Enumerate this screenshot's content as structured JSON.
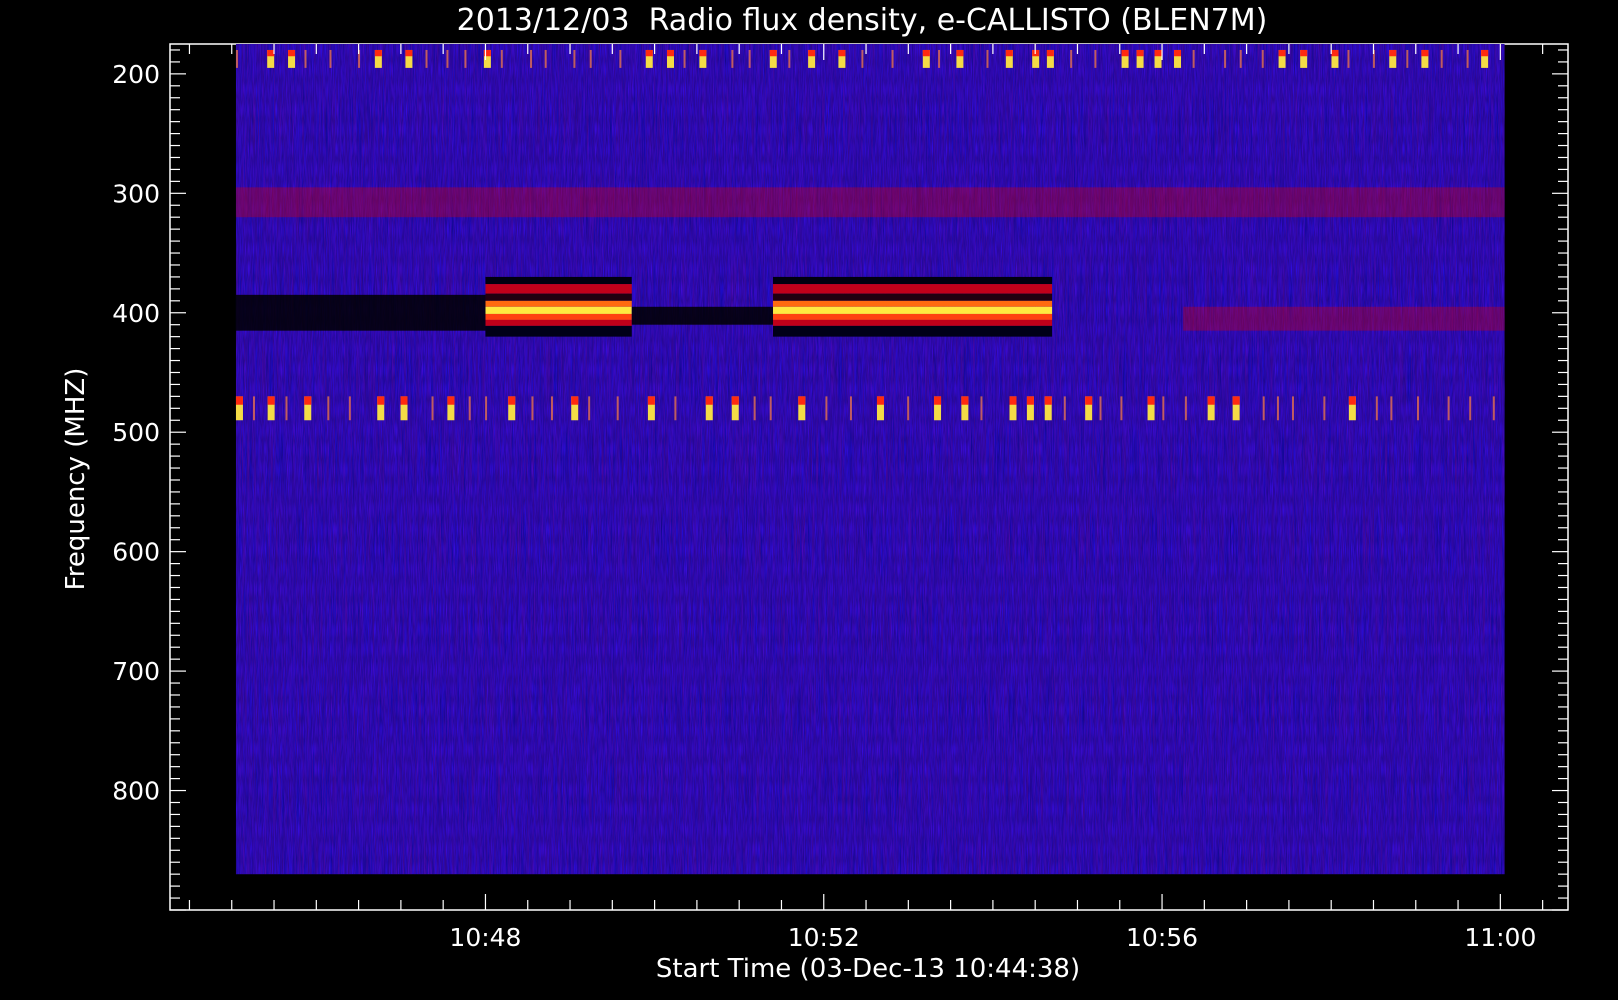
{
  "chart_data": {
    "type": "heatmap",
    "title": "2013/12/03  Radio flux density, e-CALLISTO (BLEN7M)",
    "xlabel": "Start Time (03-Dec-13 10:44:38)",
    "ylabel": "Frequency (MHZ)",
    "x_unit": "minutes after 10:44:38 UT",
    "xlim": [
      -0.78,
      15.75
    ],
    "data_x_range": [
      0,
      15.0
    ],
    "x_ticks": [
      {
        "label": "10:48",
        "value": 2.95
      },
      {
        "label": "10:52",
        "value": 6.95
      },
      {
        "label": "10:56",
        "value": 10.95
      },
      {
        "label": "11:00",
        "value": 14.95
      }
    ],
    "ylim": [
      175,
      900
    ],
    "y_reversed": true,
    "data_y_range": [
      175,
      870
    ],
    "y_ticks": [
      200,
      300,
      400,
      500,
      600,
      700,
      800
    ],
    "colormap": {
      "background_intensity": "#2a10ff",
      "low": "#000000",
      "mid": "#c0001a",
      "high": "#ffe840"
    },
    "features": [
      {
        "label": "",
        "kind": "saturated_band",
        "x_range": [
          2.95,
          4.68
        ],
        "freq_range": [
          370,
          420
        ]
      },
      {
        "label": "",
        "kind": "saturated_band",
        "x_range": [
          6.35,
          9.65
        ],
        "freq_range": [
          370,
          420
        ]
      },
      {
        "label": "",
        "kind": "dark_band",
        "x_range": [
          0,
          2.95
        ],
        "freq_range": [
          385,
          415
        ]
      },
      {
        "label": "",
        "kind": "dark_band",
        "x_range": [
          4.68,
          6.35
        ],
        "freq_range": [
          395,
          410
        ]
      },
      {
        "label": "",
        "kind": "faint_emission",
        "x_range": [
          11.2,
          15.0
        ],
        "freq_range": [
          395,
          415
        ]
      },
      {
        "label": "",
        "kind": "periodic_spikes",
        "x_range": [
          0,
          15.0
        ],
        "freq_range": [
          180,
          195
        ]
      },
      {
        "label": "",
        "kind": "periodic_spikes",
        "x_range": [
          0,
          15.0
        ],
        "freq_range": [
          470,
          490
        ]
      },
      {
        "label": "",
        "kind": "faint_emission",
        "x_range": [
          0,
          15.0
        ],
        "freq_range": [
          295,
          320
        ]
      }
    ]
  }
}
